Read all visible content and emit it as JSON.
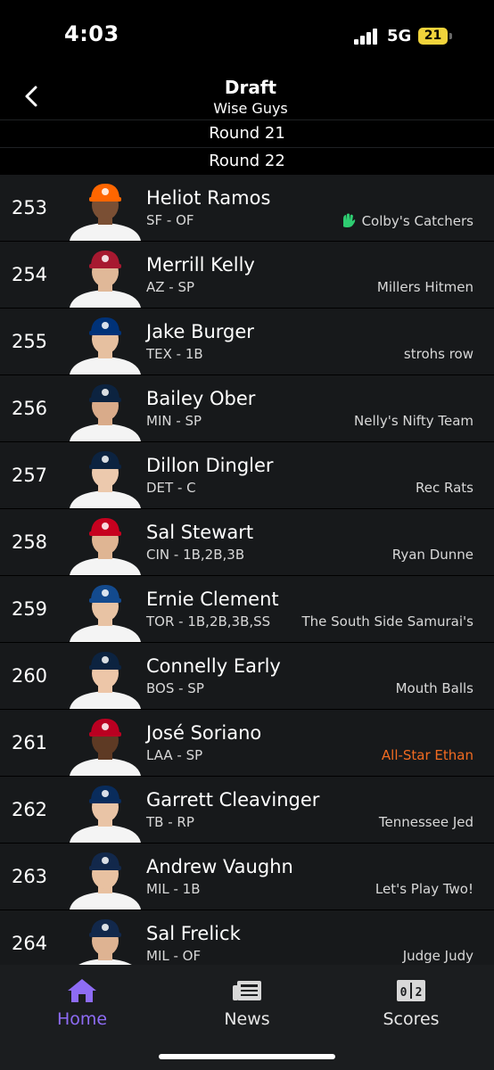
{
  "status": {
    "time": "4:03",
    "network": "5G",
    "battery": "21"
  },
  "header": {
    "title": "Draft",
    "subtitle": "Wise Guys"
  },
  "rounds": {
    "round_a": "Round 21",
    "round_b": "Round 22"
  },
  "picks": [
    {
      "num": "253",
      "name": "Heliot Ramos",
      "pos": "SF - OF",
      "team": "Colby's Catchers",
      "cap_color": "#ff6600",
      "skin": "#7a4f34"
    },
    {
      "num": "254",
      "name": "Merrill Kelly",
      "pos": "AZ - SP",
      "team": "Millers Hitmen",
      "cap_color": "#a71930",
      "skin": "#e0b898"
    },
    {
      "num": "255",
      "name": "Jake Burger",
      "pos": "TEX - 1B",
      "team": "strohs row",
      "cap_color": "#003278",
      "skin": "#e6c0a0"
    },
    {
      "num": "256",
      "name": "Bailey Ober",
      "pos": "MIN - SP",
      "team": "Nelly's Nifty Team",
      "cap_color": "#0c2340",
      "skin": "#d9ab8a"
    },
    {
      "num": "257",
      "name": "Dillon Dingler",
      "pos": "DET - C",
      "team": "Rec Rats",
      "cap_color": "#0c2340",
      "skin": "#ecc9ad"
    },
    {
      "num": "258",
      "name": "Sal Stewart",
      "pos": "CIN - 1B,2B,3B",
      "team": "Ryan Dunne",
      "cap_color": "#c6011f",
      "skin": "#dfb593"
    },
    {
      "num": "259",
      "name": "Ernie Clement",
      "pos": "TOR - 1B,2B,3B,SS",
      "team": "The South Side Samurai's",
      "cap_color": "#134a8e",
      "skin": "#e8c3a4"
    },
    {
      "num": "260",
      "name": "Connelly Early",
      "pos": "BOS - SP",
      "team": "Mouth Balls",
      "cap_color": "#0c2340",
      "skin": "#edc6a8"
    },
    {
      "num": "261",
      "name": "José Soriano",
      "pos": "LAA - SP",
      "team": "All-Star Ethan",
      "cap_color": "#ba0021",
      "skin": "#5e3a24"
    },
    {
      "num": "262",
      "name": "Garrett Cleavinger",
      "pos": "TB - RP",
      "team": "Tennessee Jed",
      "cap_color": "#092c5c",
      "skin": "#e9c4a6"
    },
    {
      "num": "263",
      "name": "Andrew Vaughn",
      "pos": "MIL - 1B",
      "team": "Let's Play Two!",
      "cap_color": "#12284b",
      "skin": "#e8c1a1"
    },
    {
      "num": "264",
      "name": "Sal Frelick",
      "pos": "MIL - OF",
      "team": "Judge Judy",
      "cap_color": "#12284b",
      "skin": "#deb392"
    }
  ],
  "tabs": {
    "home": "Home",
    "news": "News",
    "scores": "Scores"
  },
  "colors": {
    "accent": "#8e6cf5",
    "highlight_team": "#f26b21",
    "catcher_icon": "#2ecc71"
  },
  "icons": {
    "back": "chevron-left-icon",
    "catcher": "catcher-mitt-icon",
    "home": "house-icon",
    "news": "newspaper-icon",
    "scores": "scoreboard-icon"
  }
}
